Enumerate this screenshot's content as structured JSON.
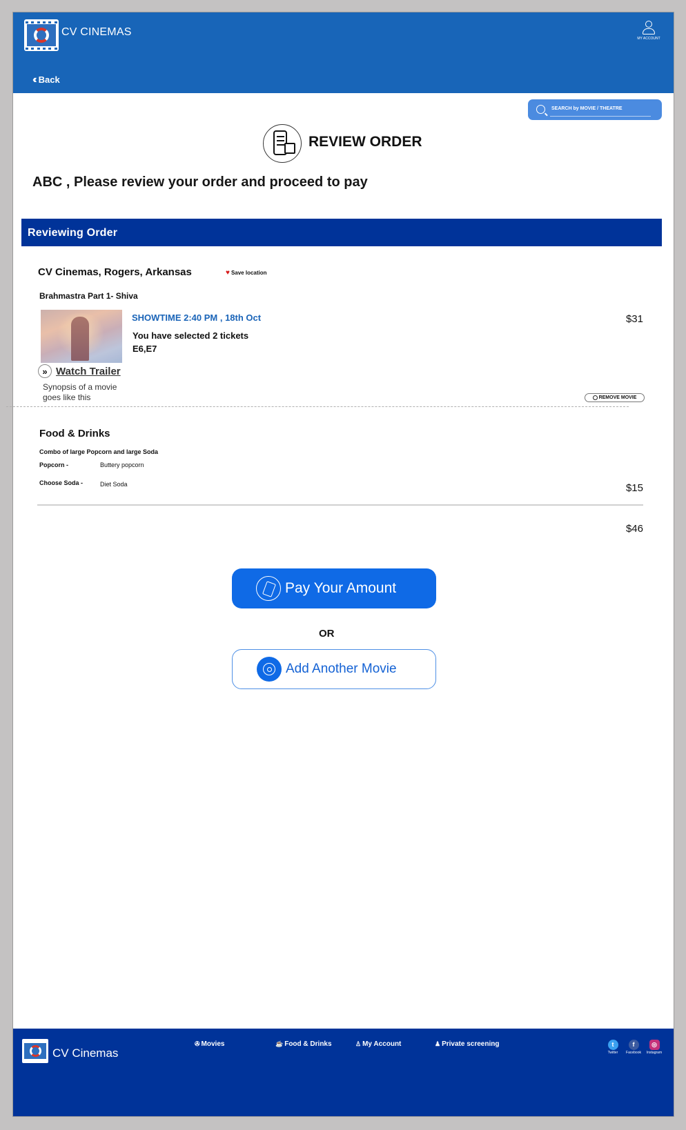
{
  "header": {
    "brand": "CV CINEMAS",
    "account_label": "MY ACCOUNT",
    "back_label": "Back"
  },
  "search": {
    "placeholder": "SEARCH  by MOVIE / THEATRE"
  },
  "page": {
    "title": "REVIEW ORDER",
    "greeting": "ABC , Please review your order and proceed to pay",
    "section_bar": "Reviewing Order"
  },
  "order": {
    "theatre": "CV Cinemas, Rogers, Arkansas",
    "save_location": "Save location",
    "movie_title": "Brahmastra Part 1- Shiva",
    "showtime": "SHOWTIME  2:40 PM , 18th Oct",
    "tickets": "You have selected 2 tickets",
    "seats": "E6,E7",
    "movie_price": "$31",
    "watch_trailer": "Watch Trailer",
    "synopsis": "Synopsis of a movie goes like this",
    "remove_movie": "REMOVE MOVIE"
  },
  "food": {
    "title": "Food & Drinks",
    "combo": "Combo of large Popcorn and large Soda",
    "options": [
      {
        "label": "Popcorn -",
        "value": "Buttery popcorn"
      },
      {
        "label": "Choose Soda -",
        "value": "Diet Soda"
      }
    ],
    "price": "$15"
  },
  "total": "$46",
  "actions": {
    "pay": "Pay Your Amount",
    "or": "OR",
    "add_movie": "Add Another Movie"
  },
  "footer": {
    "brand": "CV Cinemas",
    "nav": [
      "Movies",
      "Food & Drinks",
      "My Account",
      "Private screening"
    ],
    "social": [
      "Twitter",
      "Facebook",
      "Instagram"
    ]
  },
  "colors": {
    "header_blue": "#1865b8",
    "section_blue": "#003399",
    "button_blue": "#0f6ae6",
    "showtime_blue": "#1a64b8",
    "heart_red": "#d61818"
  }
}
